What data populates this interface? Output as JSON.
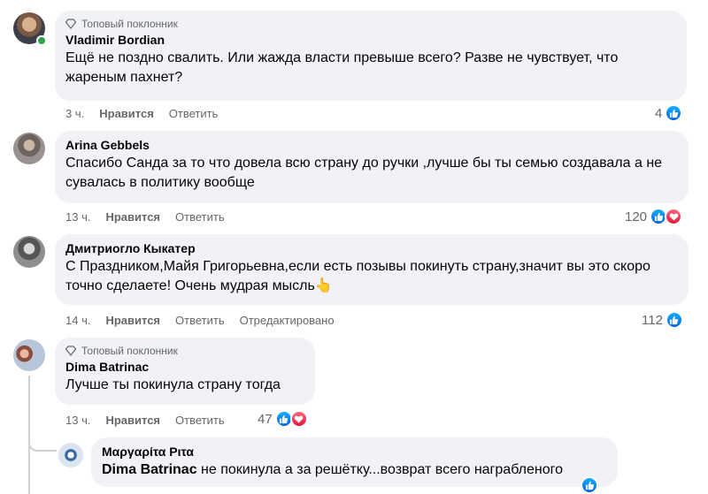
{
  "comments": [
    {
      "badge": "Топовый поклонник",
      "author": "Vladimir Bordian",
      "text": "Ещё не поздно свалить. Или жажда власти превыше всего? Разве не чувствует, что жареным пахнет?",
      "time": "3 ч.",
      "like_label": "Нравится",
      "reply_label": "Ответить",
      "reaction_count": "4",
      "reactions": [
        "like-icon"
      ],
      "online": true
    },
    {
      "author": "Arina Gebbels",
      "text": "Спасибо Санда за то что довела всю страну до ручки ,лучше бы ты семью создавала а не сувалась в политику вообще",
      "time": "13 ч.",
      "like_label": "Нравится",
      "reply_label": "Ответить",
      "reaction_count": "120",
      "reactions": [
        "like-icon",
        "love-icon"
      ]
    },
    {
      "author": "Дмитриогло Кыкатер",
      "text": "С Праздником,Майя Григорьевна,если есть позывы покинуть страну,значит вы это скоро точно сделаете! Очень мудрая мысль👆",
      "time": "14 ч.",
      "like_label": "Нравится",
      "reply_label": "Ответить",
      "edited_label": "Отредактировано",
      "reaction_count": "112",
      "reactions": [
        "like-icon"
      ]
    },
    {
      "badge": "Топовый поклонник",
      "author": "Dima Batrinac",
      "text": "Лучше ты покинула страну тогда",
      "time": "13 ч.",
      "like_label": "Нравится",
      "reply_label": "Ответить",
      "reaction_count": "47",
      "reactions": [
        "like-icon",
        "love-icon"
      ]
    },
    {
      "author": "Μαργαρίτα Ριτα",
      "mention": "Dima Batrinac",
      "text": " не покинула а за решётку...возврат всего награбленого"
    }
  ],
  "colors": {
    "bubble": "#f0f2f5",
    "meta": "#65676b",
    "like": "#0866ff",
    "love": "#f33e58",
    "online": "#31a24c"
  }
}
